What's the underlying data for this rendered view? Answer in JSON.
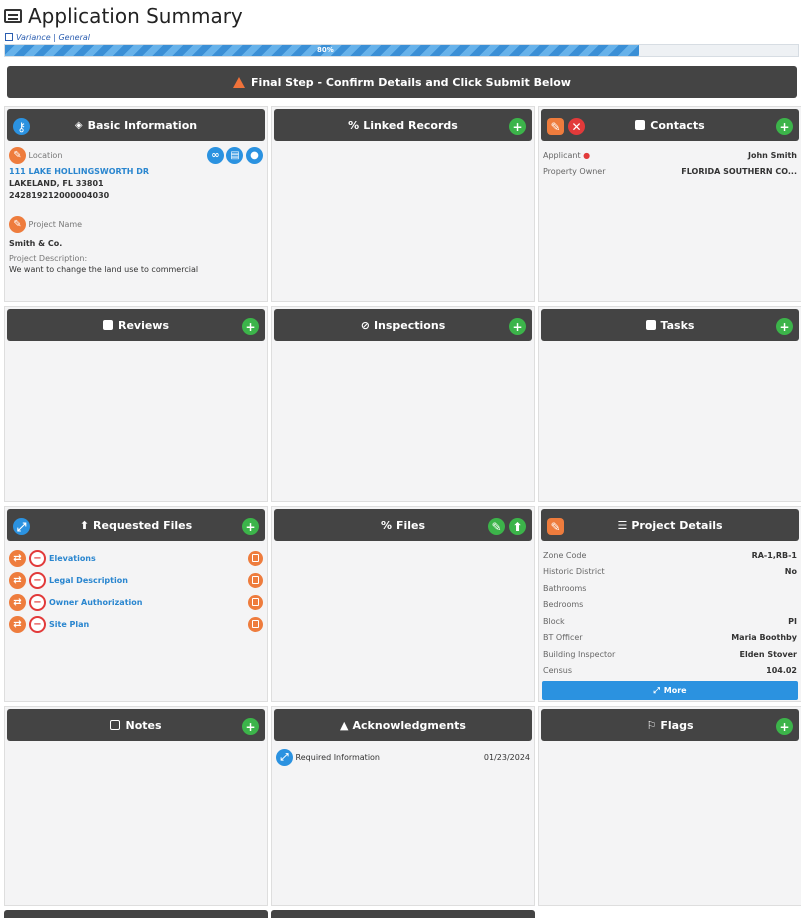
{
  "page": {
    "title": "Application Summary",
    "breadcrumb": [
      "Variance",
      "General"
    ],
    "progress": {
      "value": 0.8,
      "label": "80%"
    },
    "banner": "Final Step - Confirm Details and Click Submit Below"
  },
  "basic_info": {
    "title": "Basic Information",
    "location_label": "Location",
    "address_line1": "111 LAKE HOLLINGSWORTH DR",
    "address_line2": "LAKELAND, FL 33801",
    "parcel": "242819212000004030",
    "project_name_label": "Project Name",
    "project_name": "Smith & Co.",
    "description_label": "Project Description:",
    "description": "We want to change the land use to commercial"
  },
  "linked_records": {
    "title": "Linked Records"
  },
  "contacts": {
    "title": "Contacts",
    "rows": [
      {
        "role": "Applicant",
        "name": "John Smith"
      },
      {
        "role": "Property Owner",
        "name": "FLORIDA SOUTHERN CO..."
      }
    ]
  },
  "reviews": {
    "title": "Reviews"
  },
  "inspections": {
    "title": "Inspections"
  },
  "tasks": {
    "title": "Tasks"
  },
  "requested_files": {
    "title": "Requested Files",
    "items": [
      "Elevations",
      "Legal Description",
      "Owner Authorization",
      "Site Plan"
    ]
  },
  "files": {
    "title": "Files"
  },
  "project_details": {
    "title": "Project Details",
    "rows": [
      {
        "k": "Zone Code",
        "v": "RA-1,RB-1"
      },
      {
        "k": "Historic District",
        "v": "No"
      },
      {
        "k": "Bathrooms",
        "v": ""
      },
      {
        "k": "Bedrooms",
        "v": ""
      },
      {
        "k": "Block",
        "v": "PI"
      },
      {
        "k": "BT Officer",
        "v": "Maria Boothby"
      },
      {
        "k": "Building Inspector",
        "v": "Elden Stover"
      },
      {
        "k": "Census",
        "v": "104.02"
      }
    ],
    "more_label": "More"
  },
  "notes": {
    "title": "Notes"
  },
  "acknowledgments": {
    "title": "Acknowledgments",
    "item_label": "Required Information",
    "item_date": "01/23/2024"
  },
  "flags": {
    "title": "Flags"
  },
  "colors": {
    "header": "#444444",
    "green": "#3cb44a",
    "blue": "#2b92e0",
    "orange": "#ee7c3d",
    "red": "#e23a3a"
  }
}
